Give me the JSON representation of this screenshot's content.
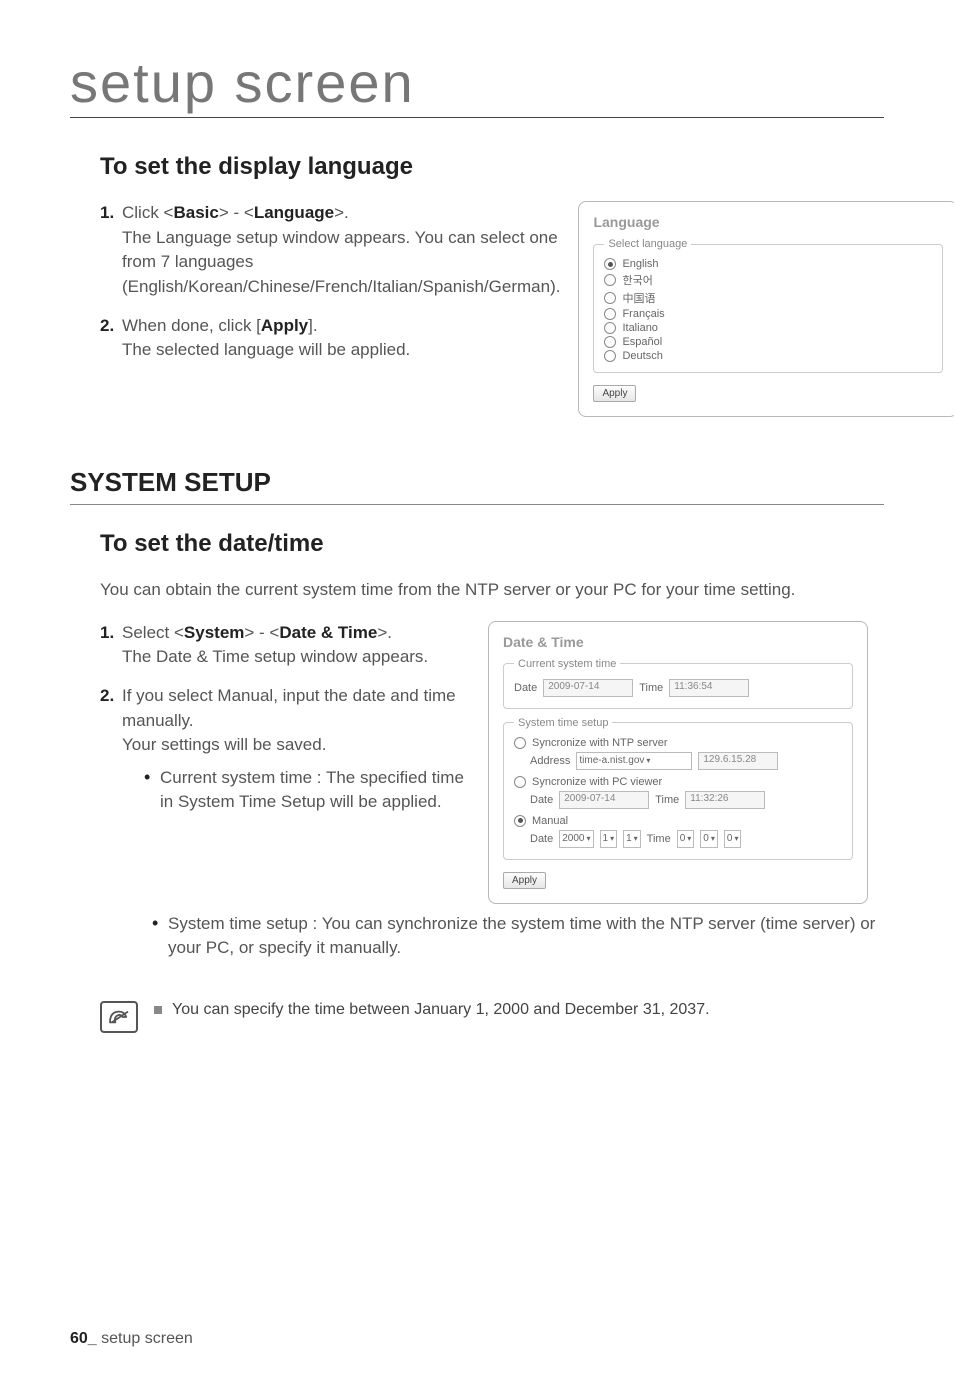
{
  "chapter_title": "setup screen",
  "lang_section": {
    "heading": "To set the display language",
    "steps": [
      {
        "num": "1.",
        "lead": "Click <",
        "b1": "Basic",
        "mid": "> - <",
        "b2": "Language",
        "tail": ">. The Language setup window appears. You can select one from 7 languages (English/Korean/Chinese/French/Italian/Spanish/German)."
      },
      {
        "num": "2.",
        "lead": "When done, click [",
        "b1": "Apply",
        "tail": "]. The selected language will be applied."
      }
    ],
    "panel": {
      "title": "Language",
      "legend": "Select language",
      "options": [
        "English",
        "한국어",
        "中国语",
        "Français",
        "Italiano",
        "Español",
        "Deutsch"
      ],
      "apply": "Apply"
    }
  },
  "system_heading": "SYSTEM SETUP",
  "dt_section": {
    "heading": "To set the date/time",
    "intro": "You can obtain the current system time from the NTP server or your PC for your time setting.",
    "steps": [
      {
        "num": "1.",
        "lead": "Select <",
        "b1": "System",
        "mid": "> - <",
        "b2": "Date & Time",
        "tail": ">. The Date & Time setup window appears."
      },
      {
        "num": "2.",
        "text": "If you select Manual, input the date and time manually.",
        "text2": "Your settings will be saved."
      }
    ],
    "bullets": [
      "Current system time : The specified time in System Time Setup will be applied.",
      "System time setup : You can synchronize the system time with the NTP server (time server) or your PC, or specify it manually."
    ],
    "panel": {
      "title": "Date & Time",
      "cur_legend": "Current system time",
      "cur_date_label": "Date",
      "cur_date": "2009-07-14",
      "cur_time_label": "Time",
      "cur_time": "11:36:54",
      "sts_legend": "System time setup",
      "ntp_label": "Syncronize with NTP server",
      "addr_label": "Address",
      "addr_val": "time-a.nist.gov",
      "addr_ip": "129.6.15.28",
      "pc_label": "Syncronize with PC viewer",
      "pc_date": "2009-07-14",
      "pc_time": "11:32:26",
      "manual_label": "Manual",
      "manual_date_label": "Date",
      "manual_y": "2000",
      "manual_m": "1",
      "manual_d": "1",
      "manual_time_label": "Time",
      "manual_h": "0",
      "manual_mi": "0",
      "manual_s": "0",
      "apply": "Apply"
    }
  },
  "note": "You can specify the time between January 1, 2000 and December 31, 2037.",
  "footer_page": "60_",
  "footer_text": " setup screen"
}
